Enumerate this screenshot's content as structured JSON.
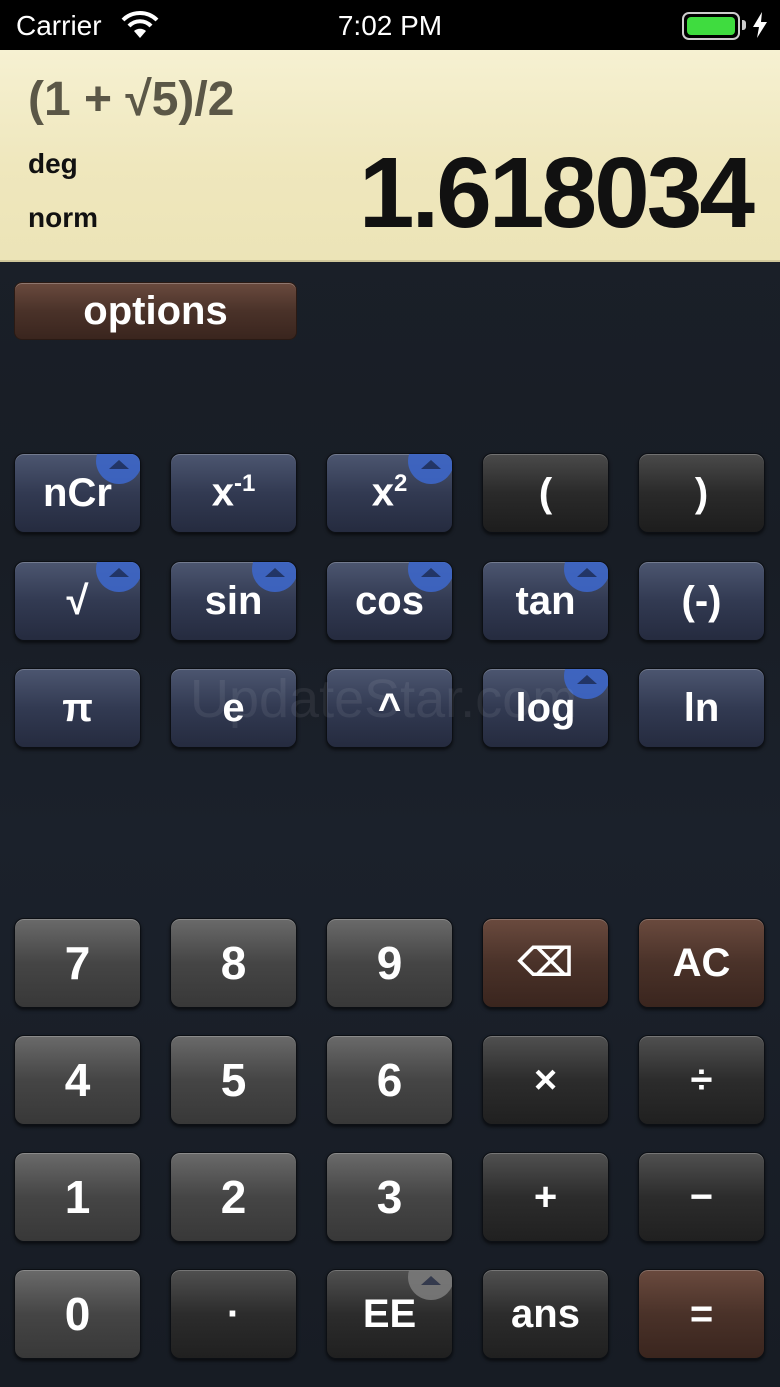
{
  "status_bar": {
    "carrier": "Carrier",
    "time": "7:02 PM",
    "icons": [
      "wifi-icon",
      "battery-icon",
      "charging-bolt-icon"
    ]
  },
  "display": {
    "expression": "(1 + √5)/2",
    "angle_mode": "deg",
    "number_mode": "norm",
    "result": "1.618034",
    "colors": {
      "background": "#efe7bd",
      "text": "#111111"
    }
  },
  "options_label": "options",
  "scientific_keys": [
    [
      "nCr",
      "x⁻¹",
      "x²",
      "(",
      ")"
    ],
    [
      "√",
      "sin",
      "cos",
      "tan",
      "(-)"
    ],
    [
      "π",
      "e",
      "^",
      "log",
      "ln"
    ]
  ],
  "number_keys": [
    [
      "7",
      "8",
      "9",
      "⌫",
      "AC"
    ],
    [
      "4",
      "5",
      "6",
      "×",
      "÷"
    ],
    [
      "1",
      "2",
      "3",
      "+",
      "−"
    ],
    [
      "0",
      "·",
      "EE",
      "ans",
      "="
    ]
  ],
  "watermark": "UpdateStar.com",
  "colors": {
    "accent_badge": "#3d66c8",
    "brown_key": "#4a3229",
    "sci_key": "#323a52"
  }
}
